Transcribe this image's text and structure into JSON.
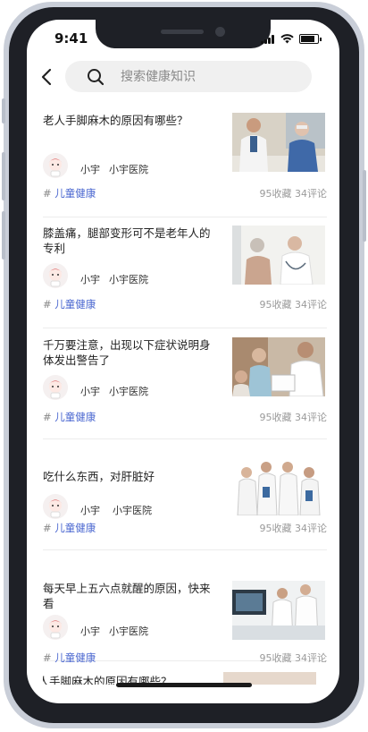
{
  "status_bar": {
    "time": "9:41"
  },
  "search": {
    "placeholder": "搜索健康知识"
  },
  "articles": [
    {
      "title": "老人手脚麻木的原因有哪些？",
      "author": "小宇",
      "hospital": "小宇医院",
      "tag_prefix": "#",
      "tag": "儿童健康",
      "favorites": "95收藏",
      "comments": "34评论"
    },
    {
      "title": "膝盖痛，腿部变形可不是老年人的专利",
      "author": "小宇",
      "hospital": "小宇医院",
      "tag_prefix": "#",
      "tag": "儿童健康",
      "favorites": "95收藏",
      "comments": "34评论"
    },
    {
      "title": "千万要注意，出现以下症状说明身体发出警告了",
      "author": "小宇",
      "hospital": "小宇医院",
      "tag_prefix": "#",
      "tag": "儿童健康",
      "favorites": "95收藏",
      "comments": "34评论"
    },
    {
      "title": "吃什么东西，对肝脏好",
      "author": "小宇",
      "hospital": "小宇医院",
      "tag_prefix": "#",
      "tag": "儿童健康",
      "favorites": "95收藏",
      "comments": "34评论"
    },
    {
      "title": "每天早上五六点就醒的原因，快来看",
      "author": "小宇",
      "hospital": "小宇医院",
      "tag_prefix": "#",
      "tag": "儿童健康",
      "favorites": "95收藏",
      "comments": "34评论"
    }
  ],
  "partial_article": {
    "title": "老人手脚麻木的原因有哪些？"
  }
}
